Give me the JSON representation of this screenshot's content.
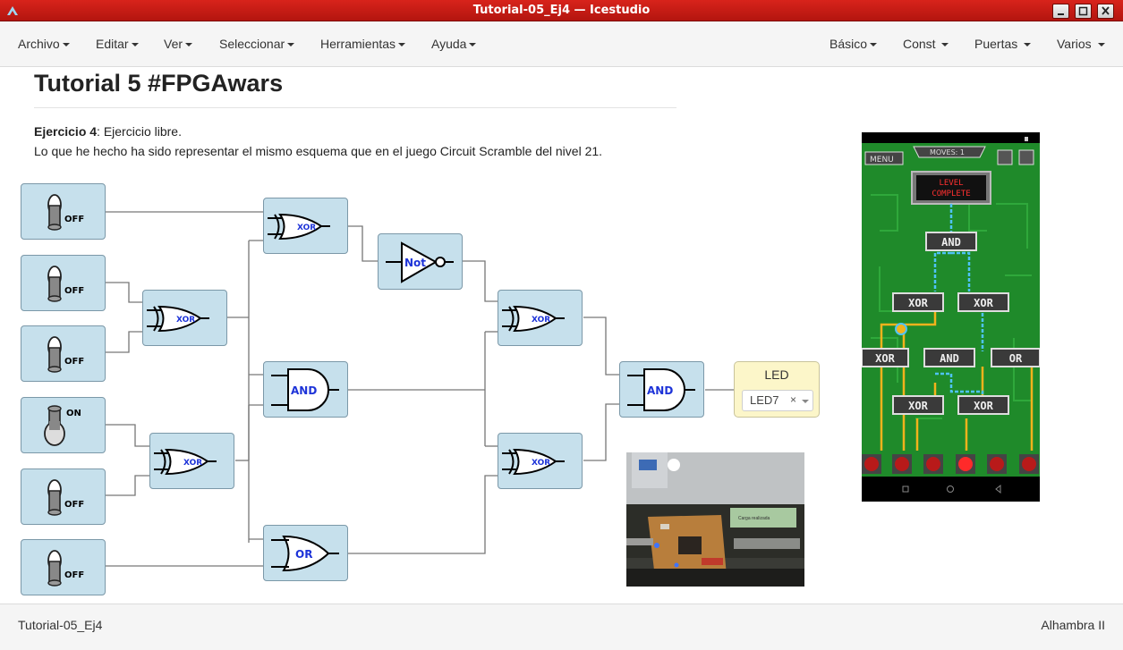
{
  "window": {
    "title": "Tutorial-05_Ej4 — Icestudio"
  },
  "menu": {
    "left": [
      "Archivo",
      "Editar",
      "Ver",
      "Seleccionar",
      "Herramientas",
      "Ayuda"
    ],
    "right": [
      "Básico",
      "Const",
      "Puertas",
      "Varios"
    ]
  },
  "page": {
    "title": "Tutorial 5 #FPGAwars",
    "exercise_bold": "Ejercicio 4",
    "exercise_rest": ": Ejercicio libre.",
    "description": "Lo que he hecho ha sido representar el mismo esquema que en el juego Circuit Scramble del nivel 21."
  },
  "circuit": {
    "switches": [
      {
        "state": "OFF"
      },
      {
        "state": "OFF"
      },
      {
        "state": "OFF"
      },
      {
        "state": "ON"
      },
      {
        "state": "OFF"
      },
      {
        "state": "OFF"
      }
    ],
    "gates": {
      "xor_a": "XOR",
      "xor_b": "XOR",
      "xor_top": "XOR",
      "not": "Not",
      "and_mid": "AND",
      "or_bottom": "OR",
      "xor_r1": "XOR",
      "xor_r2": "XOR",
      "and_final": "AND"
    },
    "led": {
      "title": "LED",
      "selected": "LED7",
      "clear": "×"
    }
  },
  "game": {
    "menu": "MENU",
    "moves": "MOVES: 1",
    "level_line1": "LEVEL",
    "level_line2": "COMPLETE",
    "gate_labels": [
      "AND",
      "XOR",
      "XOR",
      "XOR",
      "AND",
      "OR",
      "XOR",
      "XOR"
    ]
  },
  "photo": {
    "screen_text": "Carga realizada"
  },
  "status": {
    "left": "Tutorial-05_Ej4",
    "right": "Alhambra II"
  }
}
